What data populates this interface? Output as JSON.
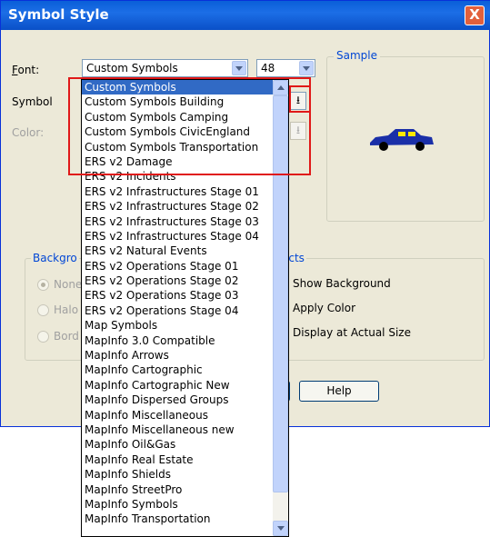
{
  "window": {
    "title": "Symbol Style",
    "close_glyph": "X"
  },
  "font": {
    "label": "Font:",
    "value": "Custom Symbols",
    "size": "48"
  },
  "symbol": {
    "label": "Symbol"
  },
  "color": {
    "label": "Color:"
  },
  "sample": {
    "label": "Sample"
  },
  "background": {
    "legend": "Backgro",
    "none_label": "None",
    "halo_label": "Halo",
    "border_label": "Bord"
  },
  "effects": {
    "legend": "ects",
    "show_background": "Show Background",
    "apply_color": "Apply Color",
    "display_actual": "Display at Actual Size"
  },
  "buttons": {
    "help": "Help"
  },
  "font_list": {
    "selected_index": 0,
    "items": [
      "Custom Symbols",
      "Custom Symbols Building",
      "Custom Symbols Camping",
      "Custom Symbols CivicEngland",
      "Custom Symbols Transportation",
      "ERS v2 Damage",
      "ERS v2 Incidents",
      "ERS v2 Infrastructures Stage 01",
      "ERS v2 Infrastructures Stage 02",
      "ERS v2 Infrastructures Stage 03",
      "ERS v2 Infrastructures Stage 04",
      "ERS v2 Natural Events",
      "ERS v2 Operations Stage 01",
      "ERS v2 Operations Stage 02",
      "ERS v2 Operations Stage 03",
      "ERS v2 Operations Stage 04",
      "Map Symbols",
      "MapInfo 3.0 Compatible",
      "MapInfo Arrows",
      "MapInfo Cartographic",
      "MapInfo Cartographic New",
      "MapInfo Dispersed Groups",
      "MapInfo Miscellaneous",
      "MapInfo Miscellaneous new",
      "MapInfo Oil&Gas",
      "MapInfo Real Estate",
      "MapInfo Shields",
      "MapInfo StreetPro",
      "MapInfo Symbols",
      "MapInfo Transportation"
    ]
  },
  "colors": {
    "highlight": "#316ac5",
    "annotation": "#e01818",
    "car": "#1a2fa8"
  }
}
